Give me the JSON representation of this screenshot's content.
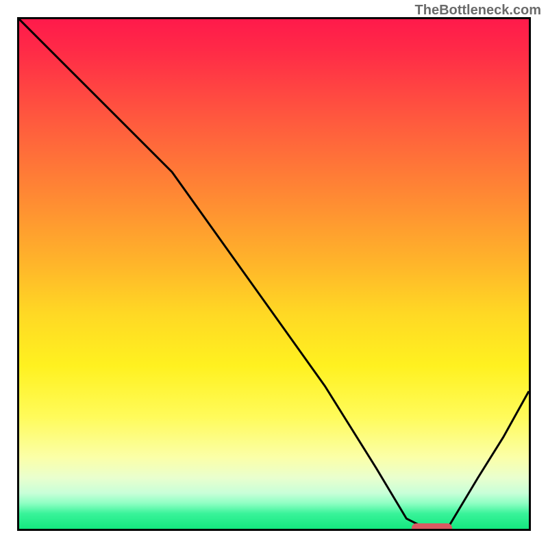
{
  "watermark": "TheBottleneck.com",
  "colors": {
    "border": "#000000",
    "marker": "#d95a62",
    "curve": "#000000"
  },
  "chart_data": {
    "type": "line",
    "title": "",
    "xlabel": "",
    "ylabel": "",
    "xlim": [
      0,
      100
    ],
    "ylim": [
      0,
      100
    ],
    "grid": false,
    "legend": false,
    "series": [
      {
        "name": "bottleneck-curve",
        "x": [
          0,
          10,
          22,
          30,
          40,
          50,
          60,
          70,
          76,
          80,
          84,
          90,
          95,
          100
        ],
        "values": [
          100,
          90,
          78,
          70,
          56,
          42,
          28,
          12,
          2,
          0,
          0,
          10,
          18,
          27
        ]
      }
    ],
    "marker": {
      "name": "optimal-range",
      "x_start": 77,
      "x_end": 85,
      "y": 0
    }
  }
}
